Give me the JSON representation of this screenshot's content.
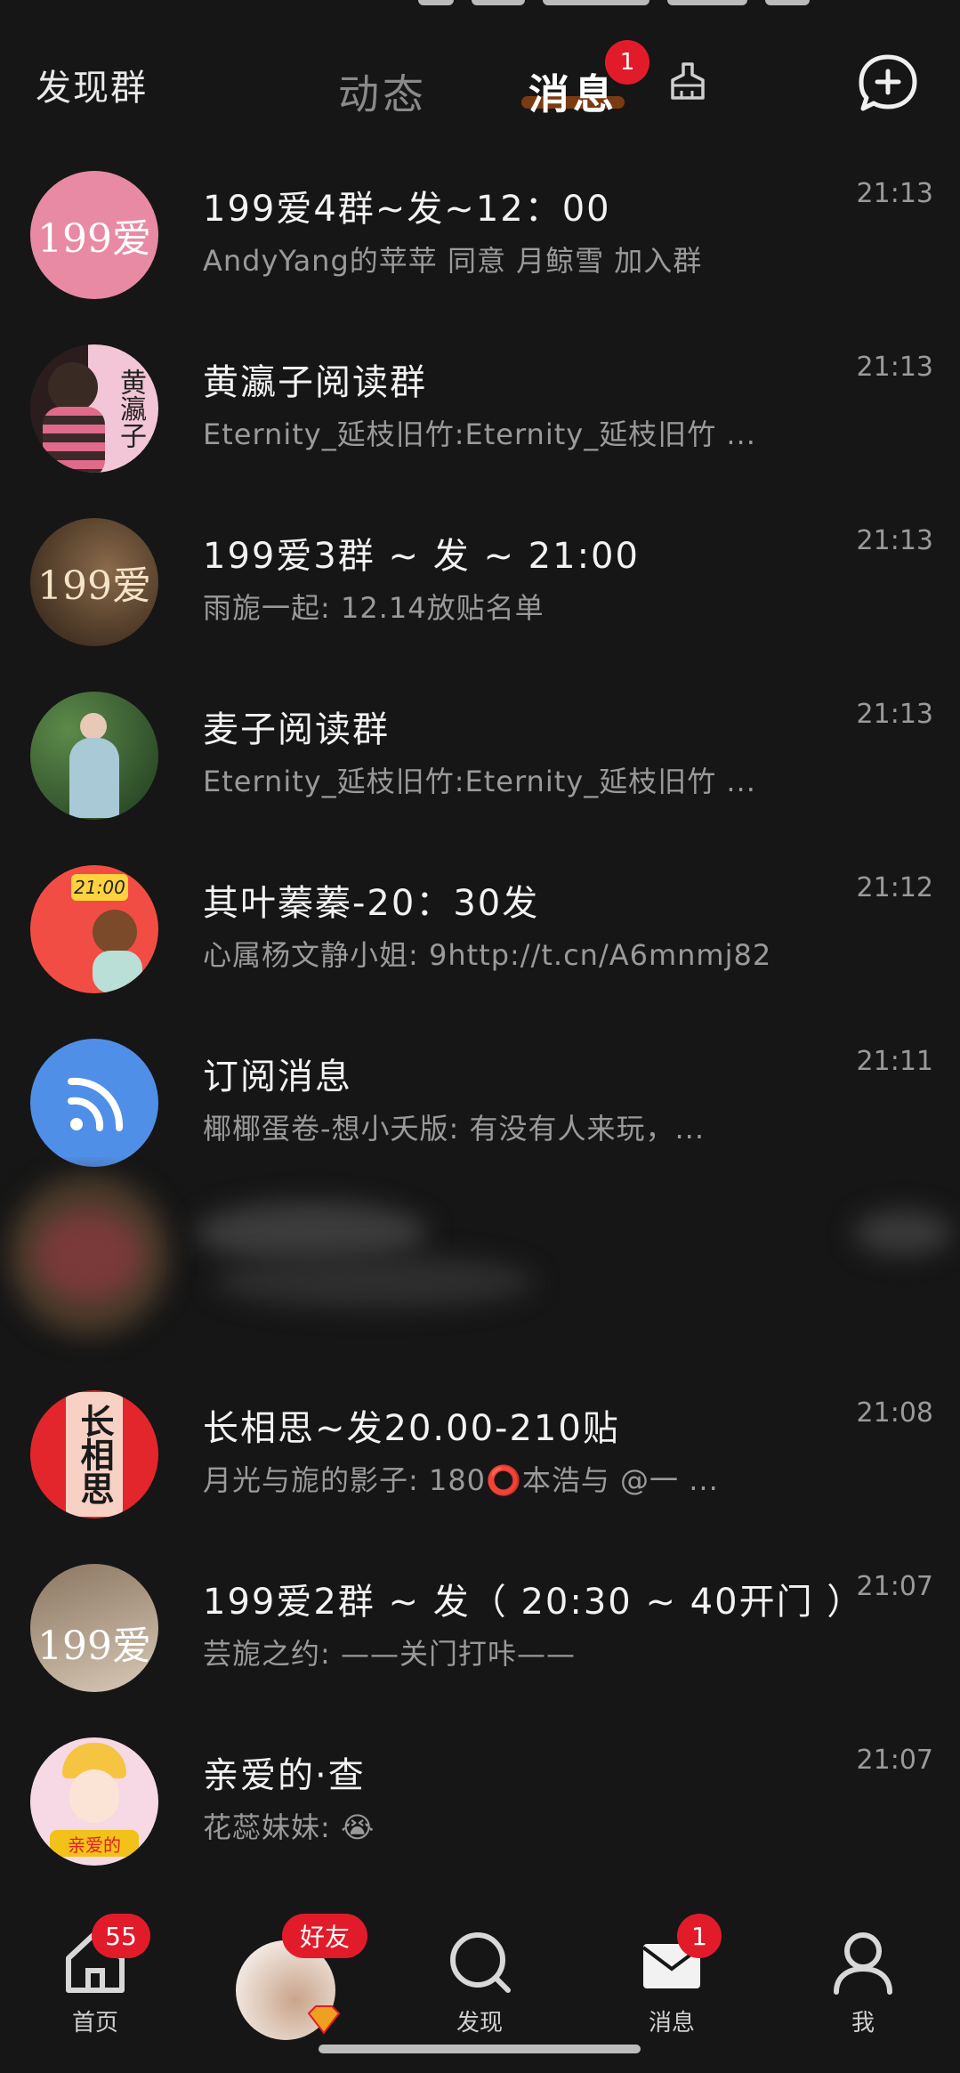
{
  "header": {
    "discover_group": "发现群",
    "tabs": [
      {
        "label": "动态"
      },
      {
        "label": "消息",
        "badge": "1"
      }
    ]
  },
  "conversations": [
    {
      "title": "199爱4群~发~12：00",
      "preview": "AndyYang的苹苹 同意 月鲸雪 加入群",
      "time": "21:13",
      "avatar_text": "199爱",
      "avatar_bg": "#e88aa4"
    },
    {
      "title": "黄瀛子阅读群",
      "preview": "Eternity_延枝旧竹:Eternity_延枝旧竹 ...",
      "time": "21:13",
      "avatar_text": "黄瀛子",
      "avatar_bg": "#f2c6d6"
    },
    {
      "title": "199爱3群 ~ 发 ~ 21:00",
      "preview": "雨旎一起: 12.14放贴名单",
      "time": "21:13",
      "avatar_text": "199爱",
      "avatar_bg": "#5b4633"
    },
    {
      "title": "麦子阅读群",
      "preview": "Eternity_延枝旧竹:Eternity_延枝旧竹 ...",
      "time": "21:13",
      "avatar_text": "",
      "avatar_bg": "#2e4a2e"
    },
    {
      "title": "其叶蓁蓁-20：30发",
      "preview": "心属杨文静小姐: 9http://t.cn/A6mnmj82",
      "time": "21:12",
      "avatar_text": "21:00",
      "avatar_bg": "#f24d45"
    },
    {
      "title": "订阅消息",
      "preview": "椰椰蛋卷-想小夭版: 有没有人来玩，...",
      "time": "21:11",
      "avatar_text": "",
      "avatar_bg": "#4f8fe8"
    },
    {
      "title": "长相思~发20.00-210贴",
      "preview": "月光与旎的影子: 180⭕本浩与 @一 ...",
      "time": "21:08",
      "avatar_text": "长相思",
      "avatar_bg": "#e2262b"
    },
    {
      "title": "199爱2群 ~ 发（ 20:30 ~ 40开门 ）",
      "preview": "芸旎之约: ——关门打咔——",
      "time": "21:07",
      "avatar_text": "199爱",
      "avatar_bg": "#b9a48b"
    },
    {
      "title": "亲爱的·查",
      "preview": "花蕊妹妹: 😭",
      "time": "21:07",
      "avatar_text": "亲爱的",
      "avatar_bg": "#f6d9e4"
    }
  ],
  "bottom_nav": {
    "home": {
      "label": "首页",
      "badge": "55"
    },
    "friends": {
      "label": "好友"
    },
    "discover": {
      "label": "发现"
    },
    "messages": {
      "label": "消息",
      "badge": "1"
    },
    "me": {
      "label": "我"
    }
  },
  "colors": {
    "accent_red": "#e21b2b",
    "background": "#161616"
  }
}
